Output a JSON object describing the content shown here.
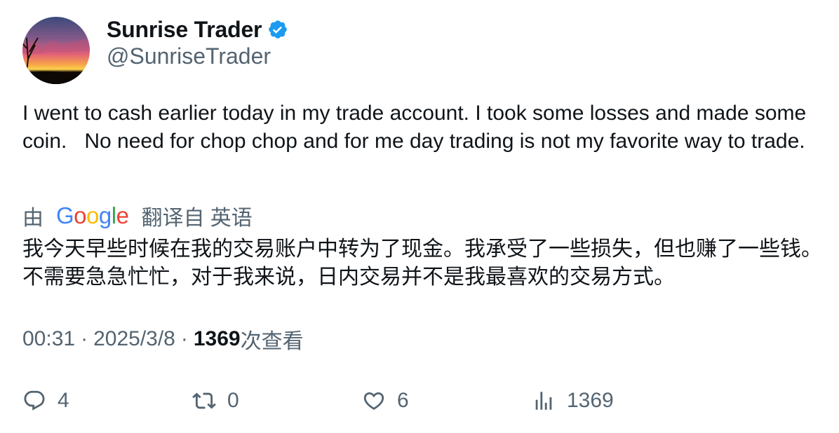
{
  "author": {
    "display_name": "Sunrise Trader",
    "handle": "@SunriseTrader",
    "verified": true
  },
  "tweet": {
    "text": "I went to cash earlier today in my trade account. I took some losses and made some coin.   No need for chop chop and for me day trading is not my favorite way to trade."
  },
  "translation": {
    "prefix": "由",
    "provider": "Google",
    "suffix": "翻译自 英语",
    "text": "我今天早些时候在我的交易账户中转为了现金。我承受了一些损失，但也赚了一些钱。不需要急急忙忙，对于我来说，日内交易并不是我最喜欢的交易方式。"
  },
  "meta": {
    "time": "00:31",
    "separator": "·",
    "date": "2025/3/8",
    "views_count": "1369",
    "views_label": "次查看"
  },
  "actions": {
    "replies": "4",
    "retweets": "0",
    "likes": "6",
    "views": "1369"
  },
  "colors": {
    "text_primary": "#0f1419",
    "text_secondary": "#536471",
    "verified_blue": "#1d9bf0"
  },
  "icons": [
    "verified-badge-icon",
    "reply-icon",
    "retweet-icon",
    "like-icon",
    "views-icon"
  ]
}
